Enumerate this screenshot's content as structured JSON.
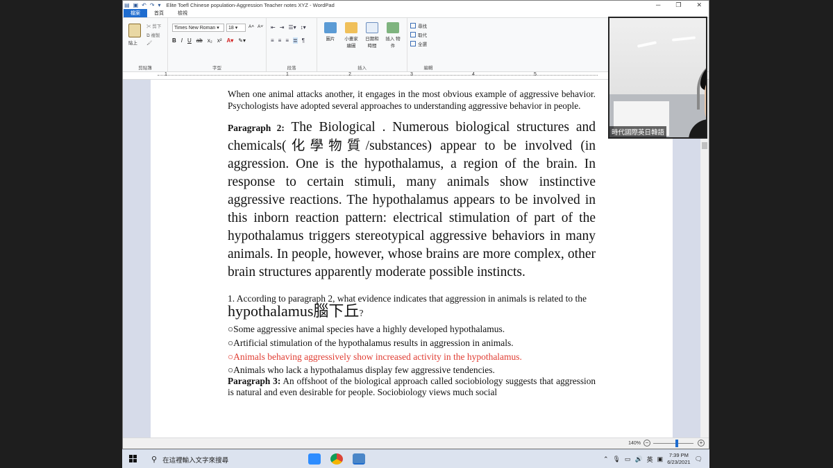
{
  "window": {
    "title": "Elite Toefl Chinese population-Aggression Teacher notes XYZ - WordPad",
    "minimize": "─",
    "maximize": "❐",
    "close": "✕"
  },
  "tabs": {
    "file": "檔案",
    "home": "首頁",
    "view": "檢視"
  },
  "ribbon": {
    "clipboard": {
      "paste": "貼上",
      "cut": "剪下",
      "copy": "複製",
      "label": "剪貼簿"
    },
    "font": {
      "family": "Times New Roman",
      "size": "18",
      "label": "字型"
    },
    "paragraph": {
      "label": "段落"
    },
    "insert": {
      "picture": "圖片",
      "paint": "小畫家\n繪圖",
      "datetime": "日期和\n時間",
      "object": "插入\n物件",
      "label": "插入"
    },
    "editing": {
      "find": "尋找",
      "replace": "取代",
      "select_all": "全選",
      "label": "編輯"
    }
  },
  "ruler": {
    "marks": [
      "1",
      "1",
      "2",
      "3",
      "4",
      "5"
    ]
  },
  "document": {
    "intro": "When one animal attacks another, it engages in the most obvious example of aggressive behavior. Psychologists have adopted several approaches to understanding aggressive behavior in people.",
    "para2_label": "Paragraph 2:",
    "para2_text_a": " The Biological . Numerous biological structures and chemicals(",
    "para2_chinese": "化學物質",
    "para2_text_b": "/substances) appear to be involved (in aggression. One is the hypothalamus, a region of the brain. In response to certain stimuli, many animals show instinctive aggressive reactions. The hypothalamus appears to be involved in this inborn reaction pattern: electrical stimulation of part of the hypothalamus triggers stereotypical aggressive behaviors in many animals. In people, however, whose brains are more complex, other brain structures apparently moderate possible instincts.",
    "question_a": "1. According to paragraph 2, what evidence indicates that aggression in animals is related to the ",
    "question_big": "hypothalamus腦下丘",
    "question_end": "?",
    "options": [
      "○Some aggressive animal species have a highly developed hypothalamus.",
      "○Artificial stimulation of the hypothalamus results in aggression in animals.",
      "○Animals behaving aggressively show increased activity in the hypothalamus.",
      "○Animals who lack a hypothalamus display few aggressive tendencies."
    ],
    "highlight_color": "#e03c32",
    "para3_label": "Paragraph 3:",
    "para3_text": " An offshoot of the biological approach called sociobiology suggests that aggression is natural and even desirable for people. Sociobiology views much social"
  },
  "status": {
    "zoom": "140%",
    "minus": "−",
    "plus": "+"
  },
  "webcam": {
    "name_tag": "時代國際英日韓語"
  },
  "taskbar": {
    "search_placeholder": "在這裡輸入文字來搜尋",
    "ime": "英",
    "time": "7:39 PM",
    "date": "6/23/2021"
  }
}
